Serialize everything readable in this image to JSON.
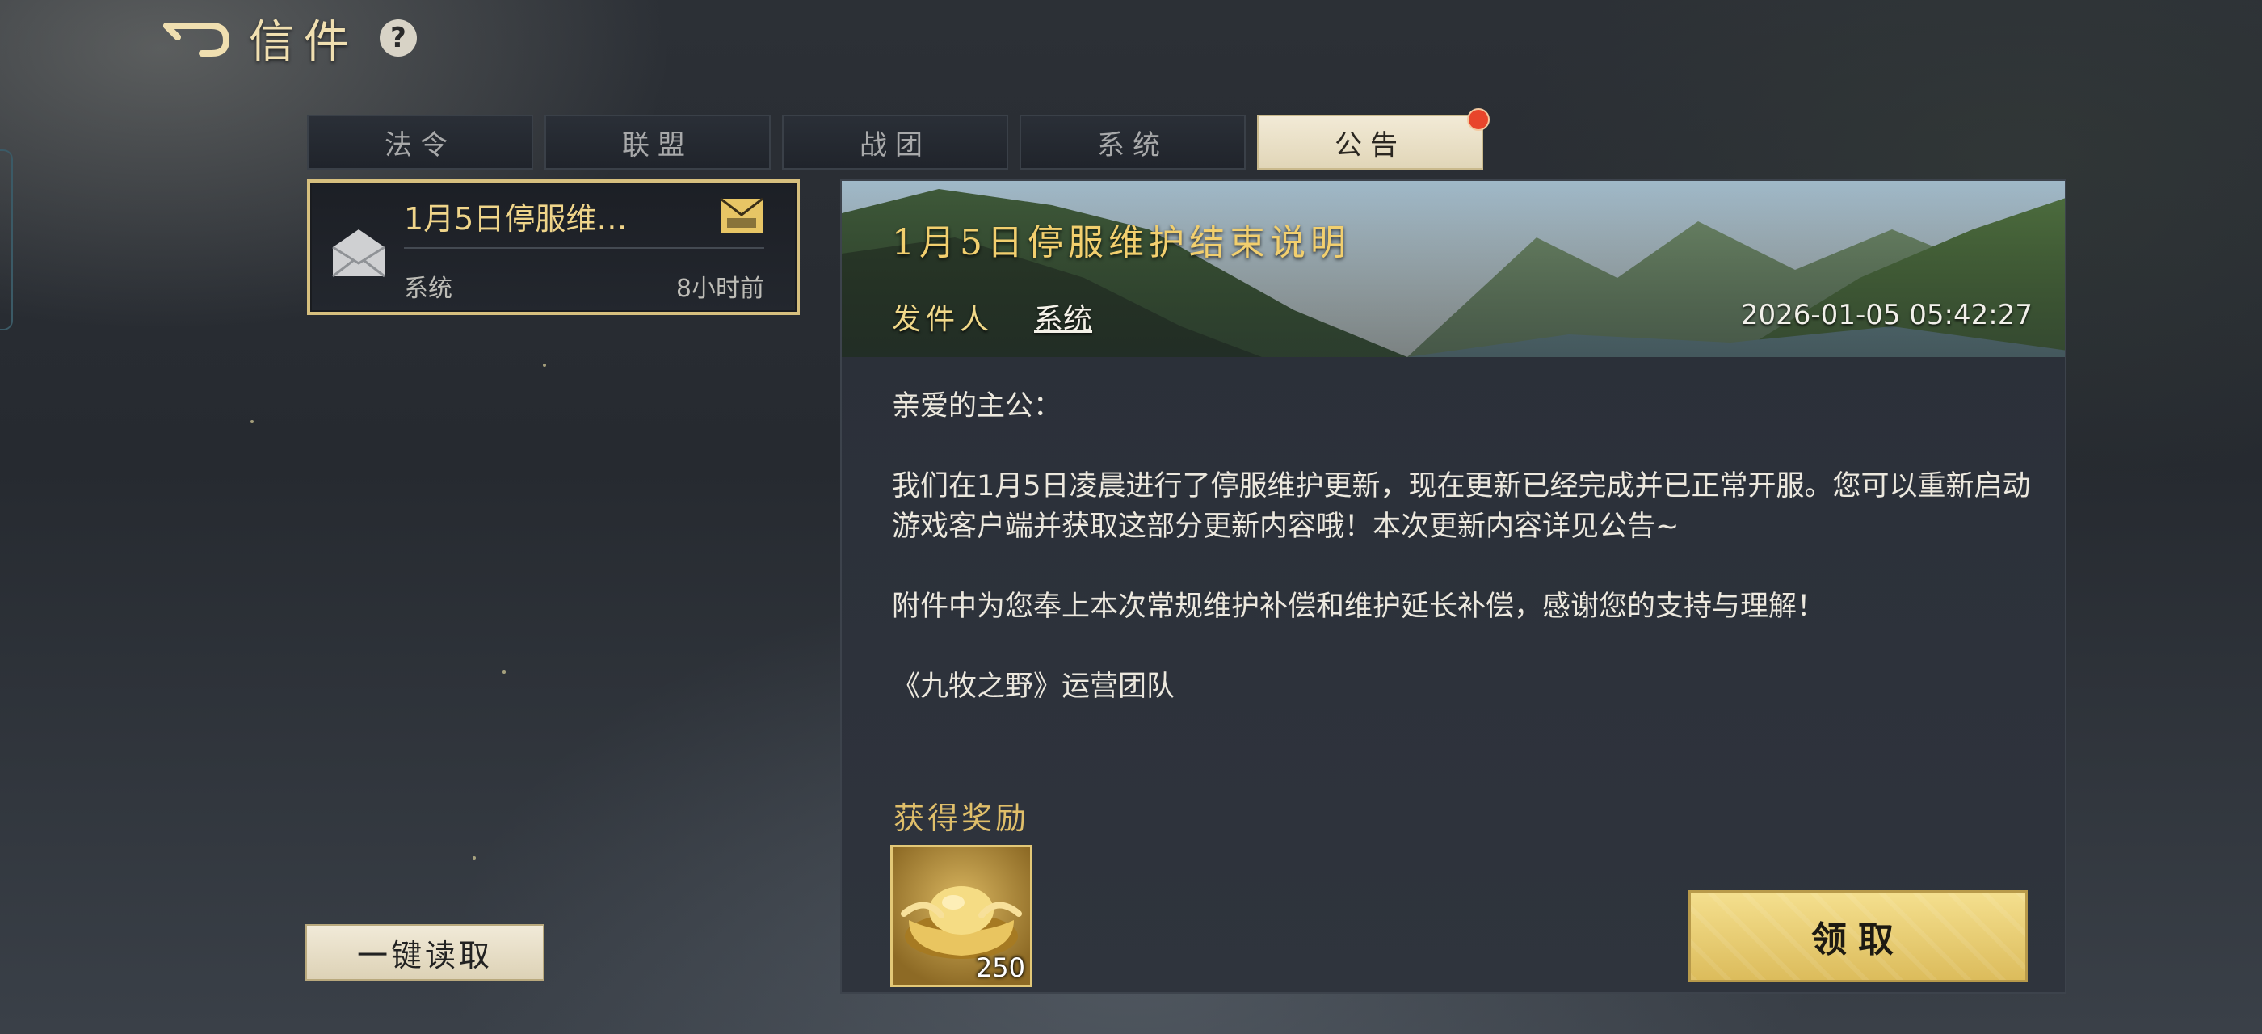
{
  "header": {
    "back_icon": "back-arrow-icon",
    "title": "信件",
    "help_icon": "help-icon",
    "help_glyph": "?"
  },
  "tabs": [
    {
      "label": "法令",
      "active": false
    },
    {
      "label": "联盟",
      "active": false
    },
    {
      "label": "战团",
      "active": false
    },
    {
      "label": "系统",
      "active": false
    },
    {
      "label": "公告",
      "active": true,
      "has_notification": true
    }
  ],
  "mail_list": [
    {
      "subject": "1月5日停服维…",
      "sender": "系统",
      "time": "8小时前",
      "icon": "envelope-icon",
      "status_icon": "open-mail-icon",
      "selected": true
    }
  ],
  "read_all_label": "一键读取",
  "detail": {
    "title": "1月5日停服维护结束说明",
    "from_label": "发件人",
    "from_value": "系统",
    "date": "2026-01-05 05:42:27",
    "body": {
      "greeting": "亲爱的主公：",
      "p1": "我们在1月5日凌晨进行了停服维护更新，现在更新已经完成并已正常开服。您可以重新启动游戏客户端并获取这部分更新内容哦！本次更新内容详见公告~",
      "p2": "附件中为您奉上本次常规维护补偿和维护延长补偿，感谢您的支持与理解！",
      "signature": "《九牧之野》运营团队"
    },
    "reward_label": "获得奖励",
    "rewards": [
      {
        "icon": "gold-ingot-icon",
        "count": "250"
      }
    ],
    "claim_label": "领取"
  },
  "colors": {
    "accent_gold": "#f2cf6e",
    "tab_active_bg": "#ece3ca",
    "notification": "#e8452b"
  }
}
